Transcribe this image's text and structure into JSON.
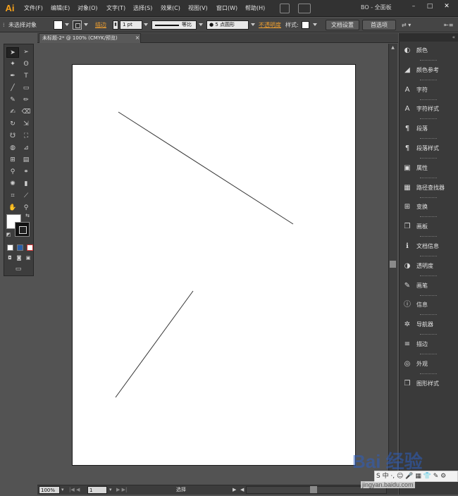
{
  "app": {
    "logo": "Ai",
    "menu": [
      "文件(F)",
      "编辑(E)",
      "对象(O)",
      "文字(T)",
      "选择(S)",
      "效果(C)",
      "视图(V)",
      "窗口(W)",
      "帮助(H)"
    ],
    "workspace": "BO - 全面板",
    "window_buttons": [
      "–",
      "□",
      "✕"
    ]
  },
  "control": {
    "selection": "未选择对象",
    "stroke_label": "描边",
    "stroke_weight": "1 pt",
    "profile": "等比",
    "brush": "● 5 点圆形",
    "opacity_label": "不透明度",
    "style_label": "样式:",
    "doc_setup": "文档设置",
    "preferences": "首选项"
  },
  "document": {
    "tab_title": "未标题-2* @ 100% (CMYK/预览)",
    "close": "×"
  },
  "status": {
    "zoom": "100%",
    "artboard": "1",
    "tool": "选择"
  },
  "panels": [
    {
      "label": "颜色",
      "icon": "◐"
    },
    {
      "label": "颜色参考",
      "icon": "◢"
    },
    {
      "label": "字符",
      "icon": "A"
    },
    {
      "label": "字符样式",
      "icon": "A"
    },
    {
      "label": "段落",
      "icon": "¶"
    },
    {
      "label": "段落样式",
      "icon": "¶"
    },
    {
      "label": "属性",
      "icon": "▣"
    },
    {
      "label": "路径查找器",
      "icon": "▦"
    },
    {
      "label": "变换",
      "icon": "⊞"
    },
    {
      "label": "画板",
      "icon": "❐"
    },
    {
      "label": "文档信息",
      "icon": "ℹ"
    },
    {
      "label": "透明度",
      "icon": "◑"
    },
    {
      "label": "画笔",
      "icon": "✎"
    },
    {
      "label": "信息",
      "icon": "ⓘ"
    },
    {
      "label": "导航器",
      "icon": "✲"
    },
    {
      "label": "描边",
      "icon": "≡"
    },
    {
      "label": "外观",
      "icon": "◎"
    },
    {
      "label": "图形样式",
      "icon": "❒"
    }
  ],
  "watermark": {
    "brand": "Bai 经验",
    "site": "jingyan.baidu.com",
    "bar": "S 中 ·, ☺ 🎤 ▦ 👕 ✎ ⚙"
  },
  "colors": {
    "accent_orange": "#f8a21b",
    "ui_dark": "#323232",
    "canvas": "#535353"
  }
}
